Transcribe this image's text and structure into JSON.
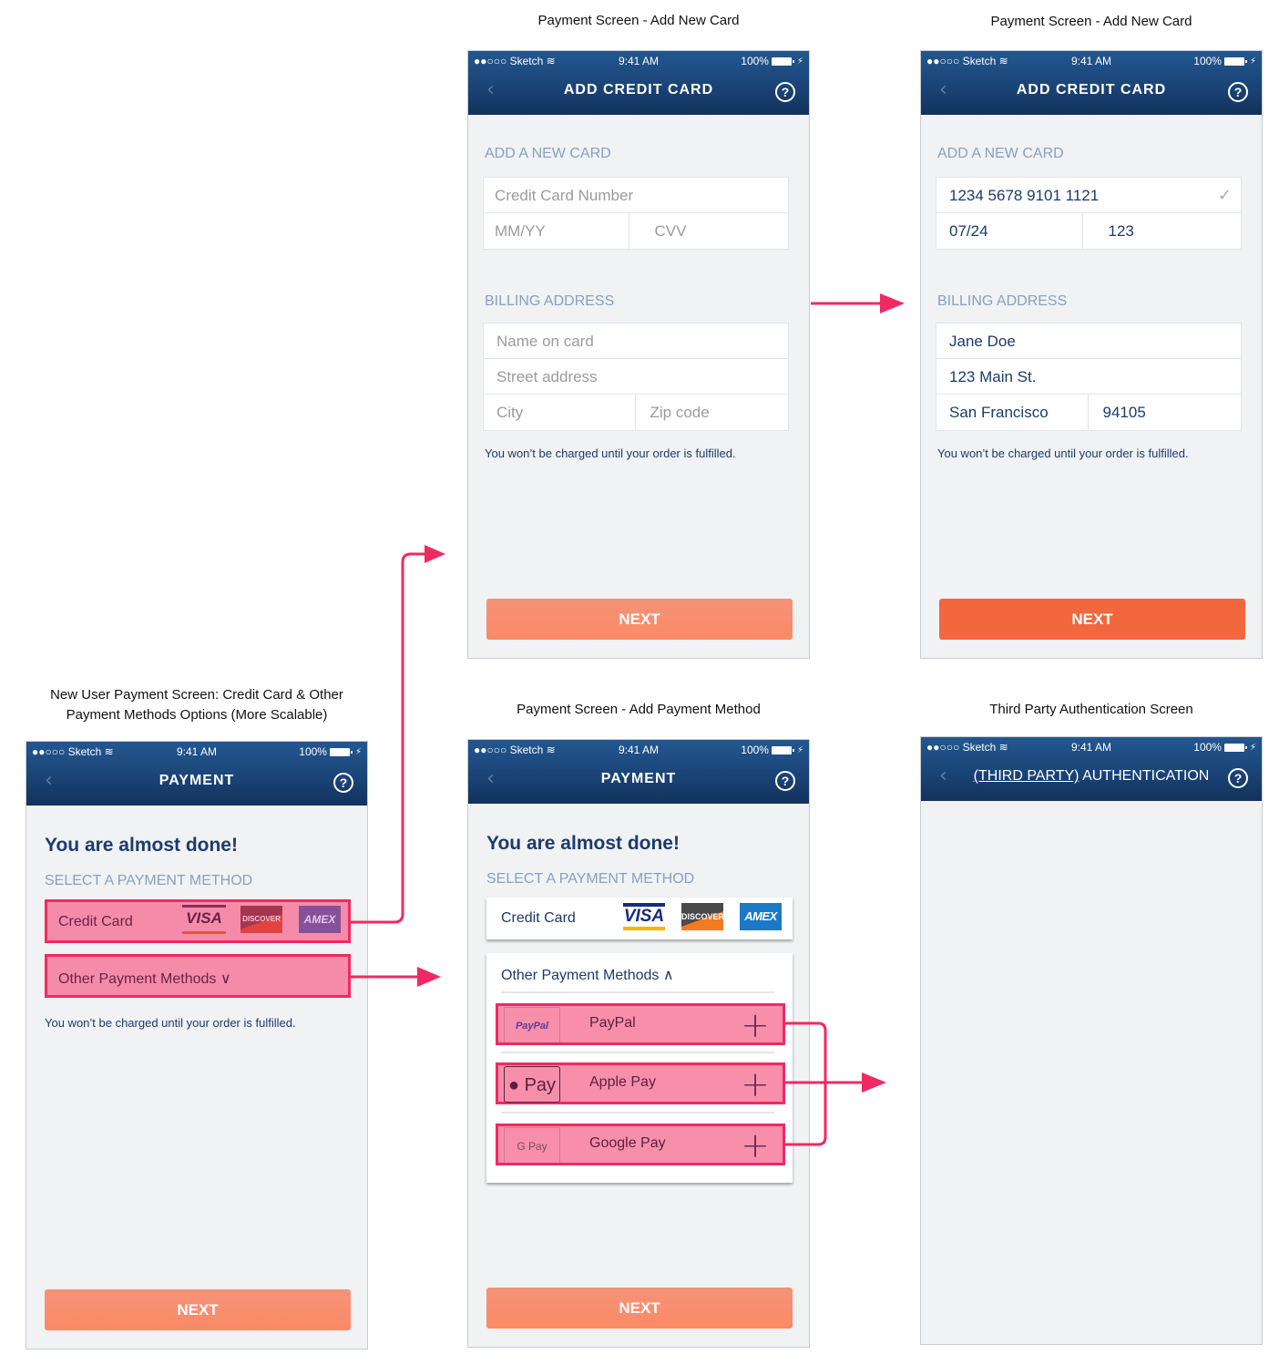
{
  "captions": {
    "screen1": "Payment Screen - Add New Card",
    "screen2": "Payment Screen - Add New Card",
    "screen3": "New User Payment Screen: Credit Card & Other Payment Methods Options (More Scalable)",
    "screen4": "Payment Screen - Add Payment Method",
    "screen5": "Third Party Authentication Screen"
  },
  "status_bar": {
    "carrier": "●●○○○ Sketch",
    "wifi_icon": "wifi-icon",
    "time": "9:41 AM",
    "battery": "100%",
    "charging_icon": "⚡"
  },
  "nav": {
    "back_icon": "‹",
    "help_icon": "?",
    "add_card_title": "ADD CREDIT CARD",
    "payment_title": "PAYMENT",
    "auth_title_underlined": "(THIRD PARTY)",
    "auth_title_rest": " AUTHENTICATION"
  },
  "add_card_empty": {
    "section_card": "ADD A NEW CARD",
    "card_number_placeholder": "Credit Card Number",
    "expiry_placeholder": "MM/YY",
    "cvv_placeholder": "CVV",
    "section_billing": "BILLING ADDRESS",
    "name_placeholder": "Name on card",
    "street_placeholder": "Street address",
    "city_placeholder": "City",
    "zip_placeholder": "Zip code",
    "note": "You won’t be charged until your order is fulfilled.",
    "next": "NEXT"
  },
  "add_card_filled": {
    "section_card": "ADD A NEW CARD",
    "card_number": "1234 5678 9101 1121",
    "check_icon": "✓",
    "expiry": "07/24",
    "cvv": "123",
    "section_billing": "BILLING ADDRESS",
    "name": "Jane Doe",
    "street": "123 Main St.",
    "city": "San Francisco",
    "zip": "94105",
    "note": "You won’t be charged until your order is fulfilled.",
    "next": "NEXT"
  },
  "payment_collapsed": {
    "hero": "You are almost done!",
    "section": "SELECT A PAYMENT METHOD",
    "credit_card": "Credit Card",
    "logos": [
      "VISA",
      "DISCOVER",
      "AMEX"
    ],
    "other_methods": "Other Payment Methods",
    "chevron": "∨",
    "note": "You won’t be charged until your order is fulfilled.",
    "next": "NEXT"
  },
  "payment_expanded": {
    "hero": "You are almost done!",
    "section": "SELECT A PAYMENT METHOD",
    "credit_card": "Credit Card",
    "logos": [
      "VISA",
      "DISCOVER",
      "AMEX"
    ],
    "other_methods": "Other Payment Methods",
    "chevron": "∧",
    "methods": [
      {
        "logo": "PayPal",
        "name": "PayPal",
        "action": "+"
      },
      {
        "logo": " Pay",
        "name": "Apple Pay",
        "action": "+"
      },
      {
        "logo": "G Pay",
        "name": "Google Pay",
        "action": "+"
      }
    ],
    "next": "NEXT"
  },
  "colors": {
    "header_top": "#235791",
    "header_bottom": "#13325d",
    "primary_text": "#1d3a6b",
    "muted_label": "#8aa0bb",
    "next_inactive": "#f8896a",
    "next_active": "#f3673f",
    "highlight": "#ef2a63"
  }
}
